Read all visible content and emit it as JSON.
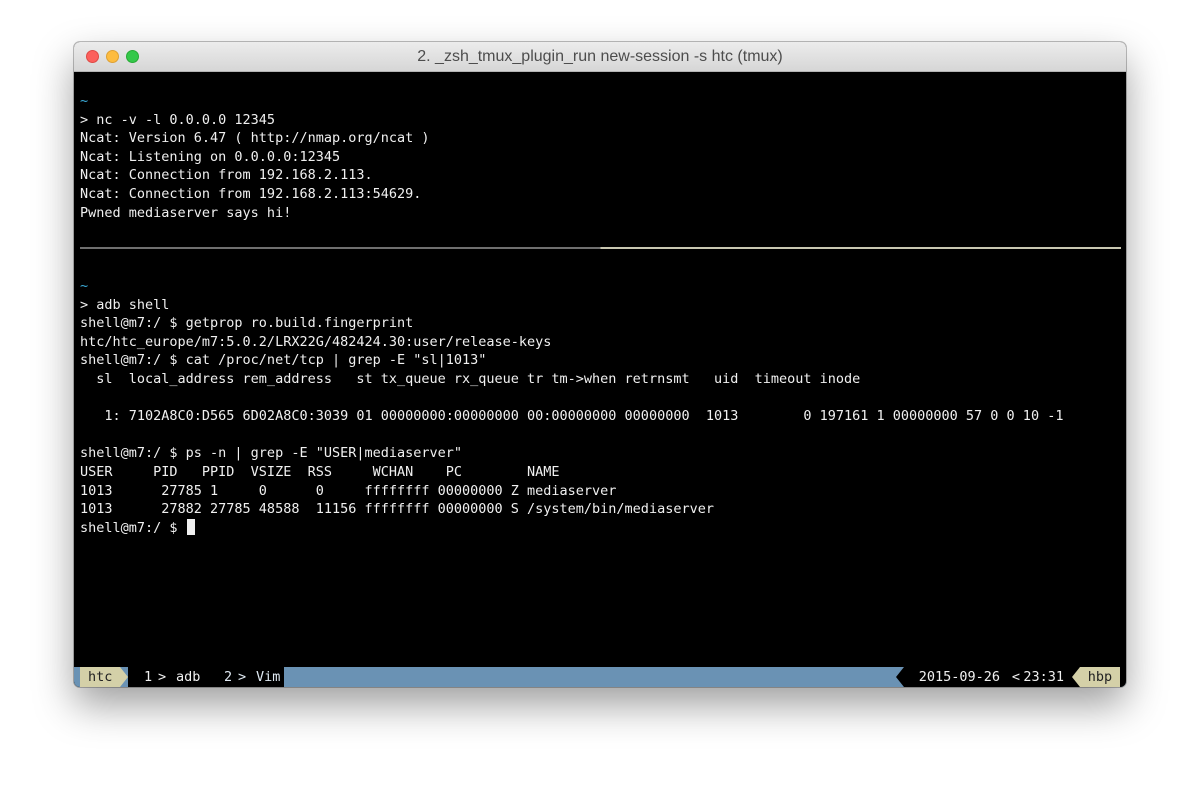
{
  "window": {
    "title": "2. _zsh_tmux_plugin_run new-session -s htc (tmux)"
  },
  "pane_top": {
    "lines": [
      "~",
      "> nc -v -l 0.0.0.0 12345",
      "Ncat: Version 6.47 ( http://nmap.org/ncat )",
      "Ncat: Listening on 0.0.0.0:12345",
      "Ncat: Connection from 192.168.2.113.",
      "Ncat: Connection from 192.168.2.113:54629.",
      "Pwned mediaserver says hi!"
    ]
  },
  "pane_bottom": {
    "lines": [
      "~",
      "> adb shell",
      "shell@m7:/ $ getprop ro.build.fingerprint",
      "htc/htc_europe/m7:5.0.2/LRX22G/482424.30:user/release-keys",
      "shell@m7:/ $ cat /proc/net/tcp | grep -E \"sl|1013\"",
      "  sl  local_address rem_address   st tx_queue rx_queue tr tm->when retrnsmt   uid  timeout inode",
      "",
      "   1: 7102A8C0:D565 6D02A8C0:3039 01 00000000:00000000 00:00000000 00000000  1013        0 197161 1 00000000 57 0 0 10 -1",
      "",
      "shell@m7:/ $ ps -n | grep -E \"USER|mediaserver\"",
      "USER     PID   PPID  VSIZE  RSS     WCHAN    PC        NAME",
      "1013      27785 1     0      0     ffffffff 00000000 Z mediaserver",
      "1013      27882 27785 48588  11156 ffffffff 00000000 S /system/bin/mediaserver"
    ],
    "prompt": "shell@m7:/ $ "
  },
  "statusbar": {
    "session": "htc",
    "window1_index": "1",
    "window1_name": "adb",
    "window2_index": "2",
    "window2_name": "Vim",
    "separator": ">",
    "right_separator": "<",
    "date": "2015-09-26",
    "time": "23:31",
    "host": "hbp"
  },
  "colors": {
    "terminal_bg": "#000000",
    "terminal_fg": "#f0f0f0",
    "tilde": "#3aa9d6",
    "status_bg": "#6a92b4",
    "status_accent": "#d4d0a8"
  }
}
